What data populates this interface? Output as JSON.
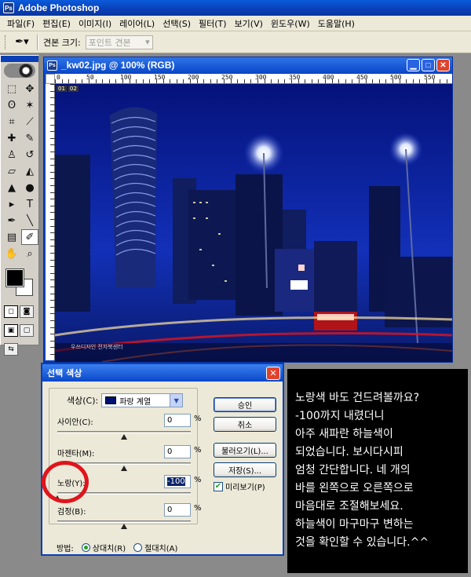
{
  "app": {
    "title": "Adobe Photoshop",
    "logo_text": "Ps"
  },
  "menu": [
    "파일(F)",
    "편집(E)",
    "이미지(I)",
    "레이어(L)",
    "선택(S)",
    "필터(T)",
    "보기(V)",
    "윈도우(W)",
    "도움말(H)"
  ],
  "options_bar": {
    "sample_size_label": "견본 크기:",
    "sample_size_value": "포인트 견본",
    "tool_icon": "eyedropper-icon"
  },
  "document": {
    "title": "_kw02.jpg @ 100% (RGB)",
    "frame_tags": [
      "01",
      "02"
    ],
    "ruler_ticks": [
      "0",
      "50",
      "100",
      "150",
      "200",
      "250",
      "300",
      "350",
      "400",
      "450",
      "500",
      "550"
    ],
    "watermark": "우쓰디자인 전자북센터",
    "colors": {
      "sky": "#0a1a7a",
      "accent_red": "#e0141c"
    }
  },
  "dialog": {
    "title": "선택 색상",
    "colors_label": "색상(C):",
    "colors_value": "파랑 계열",
    "sliders": [
      {
        "label": "사이안(C):",
        "value": "0",
        "unit": "%",
        "position": 0.5
      },
      {
        "label": "마젠타(M):",
        "value": "0",
        "unit": "%",
        "position": 0.5
      },
      {
        "label": "노랑(Y):",
        "value": "-100",
        "unit": "%",
        "position": 0.0,
        "highlighted": true
      },
      {
        "label": "검정(B):",
        "value": "0",
        "unit": "%",
        "position": 0.5
      }
    ],
    "buttons": {
      "ok": "승인",
      "cancel": "취소",
      "load": "불러오기(L)...",
      "save": "저장(S)..."
    },
    "preview_label": "미리보기(P)",
    "preview_checked": true,
    "method_label": "방법:",
    "method_relative": "상대치(R)",
    "method_absolute": "절대치(A)",
    "method_selected": "relative"
  },
  "note_lines": [
    "노랑색 바도 건드려볼까요?",
    "-100까지 내렸더니",
    "아주 새파란 하늘색이",
    "되었습니다. 보시다시피",
    "엄청 간단합니다. 네 개의",
    "바를 왼쪽으로 오른쪽으로",
    "마음대로 조절해보세요.",
    "하늘색이 마구마구 변하는",
    "것을 확인할 수 있습니다.^^"
  ]
}
